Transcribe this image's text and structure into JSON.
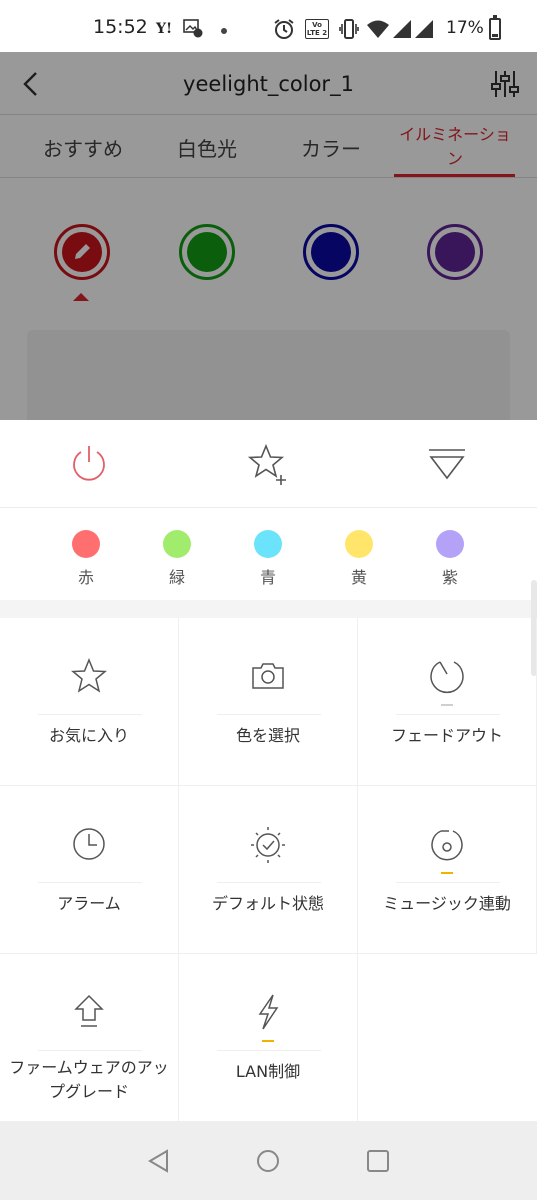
{
  "status_bar": {
    "time": "15:52",
    "yahoo": "Y!",
    "volte": "Vo LTE 2",
    "battery": "17%"
  },
  "app": {
    "title": "yeelight_color_1",
    "tabs": [
      {
        "label": "おすすめ"
      },
      {
        "label": "白色光"
      },
      {
        "label": "カラー"
      },
      {
        "label": "イルミネーション"
      }
    ],
    "swatches": [
      {
        "color": "#c8151b",
        "icon": "pencil-icon"
      },
      {
        "color": "#129d15"
      },
      {
        "color": "#0a0aa3"
      },
      {
        "color": "#5f2496"
      }
    ]
  },
  "sheet": {
    "actions": [
      {
        "icon": "power-icon"
      },
      {
        "icon": "star-add-icon"
      },
      {
        "icon": "collapse-icon"
      }
    ],
    "colors": [
      {
        "label": "赤",
        "color": "#ff6f6f"
      },
      {
        "label": "緑",
        "color": "#a2ec6d"
      },
      {
        "label": "青",
        "color": "#6ae3fb"
      },
      {
        "label": "黄",
        "color": "#ffe66a"
      },
      {
        "label": "紫",
        "color": "#b4a2f8"
      }
    ],
    "grid": [
      {
        "label": "お気に入り",
        "icon": "star-icon",
        "mark": ""
      },
      {
        "label": "色を選択",
        "icon": "camera-icon",
        "mark": ""
      },
      {
        "label": "フェードアウト",
        "icon": "fade-timer-icon",
        "mark": "#cfcfcf"
      },
      {
        "label": "アラーム",
        "icon": "clock-icon",
        "mark": ""
      },
      {
        "label": "デフォルト状態",
        "icon": "default-state-icon",
        "mark": ""
      },
      {
        "label": "ミュージック連動",
        "icon": "music-sync-icon",
        "mark": "#f0b400"
      },
      {
        "label": "ファームウェアのアップグレード",
        "icon": "upgrade-icon",
        "mark": ""
      },
      {
        "label": "LAN制御",
        "icon": "lightning-icon",
        "mark": "#f0b400"
      }
    ]
  },
  "colors": {
    "accent": "#d9262e",
    "highlight": "#f0b400"
  }
}
